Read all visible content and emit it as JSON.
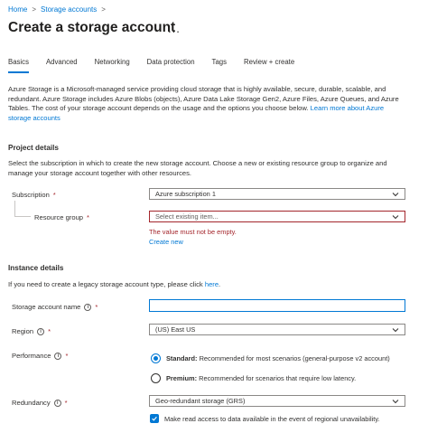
{
  "breadcrumb": {
    "home": "Home",
    "separator": ">",
    "storage_accounts": "Storage accounts"
  },
  "page_title": "Create a storage account",
  "more_label": "...",
  "tabs": [
    {
      "label": "Basics",
      "active": true
    },
    {
      "label": "Advanced"
    },
    {
      "label": "Networking"
    },
    {
      "label": "Data protection"
    },
    {
      "label": "Tags"
    },
    {
      "label": "Review + create"
    }
  ],
  "intro": {
    "text": "Azure Storage is a Microsoft-managed service providing cloud storage that is highly available, secure, durable, scalable, and redundant. Azure Storage includes Azure Blobs (objects), Azure Data Lake Storage Gen2, Azure Files, Azure Queues, and Azure Tables. The cost of your storage account depends on the usage and the options you choose below.",
    "link": "Learn more about Azure storage accounts"
  },
  "project": {
    "title": "Project details",
    "desc": "Select the subscription in which to create the new storage account. Choose a new or existing resource group to organize and manage your storage account together with other resources.",
    "subscription_label": "Subscription",
    "subscription_value": "Azure subscription 1",
    "rg_label": "Resource group",
    "rg_placeholder": "Select existing item...",
    "rg_error": "The value must not be empty.",
    "create_new": "Create new"
  },
  "instance": {
    "title": "Instance details",
    "desc_prefix": "If you need to create a legacy storage account type, please click",
    "desc_link": "here",
    "desc_suffix": ".",
    "name_label": "Storage account name",
    "name_value": "",
    "region_label": "Region",
    "region_value": "(US) East US",
    "performance_label": "Performance",
    "standard_bold": "Standard:",
    "standard_text": "Recommended for most scenarios (general-purpose v2 account)",
    "premium_bold": "Premium:",
    "premium_text": "Recommended for scenarios that require low latency.",
    "redundancy_label": "Redundancy",
    "redundancy_value": "Geo-redundant storage (GRS)",
    "read_access_label": "Make read access to data available in the event of regional unavailability."
  },
  "required_mark": "*",
  "info_glyph": "i",
  "colors": {
    "accent": "#0078d4",
    "error": "#a4262c",
    "text": "#323130"
  }
}
